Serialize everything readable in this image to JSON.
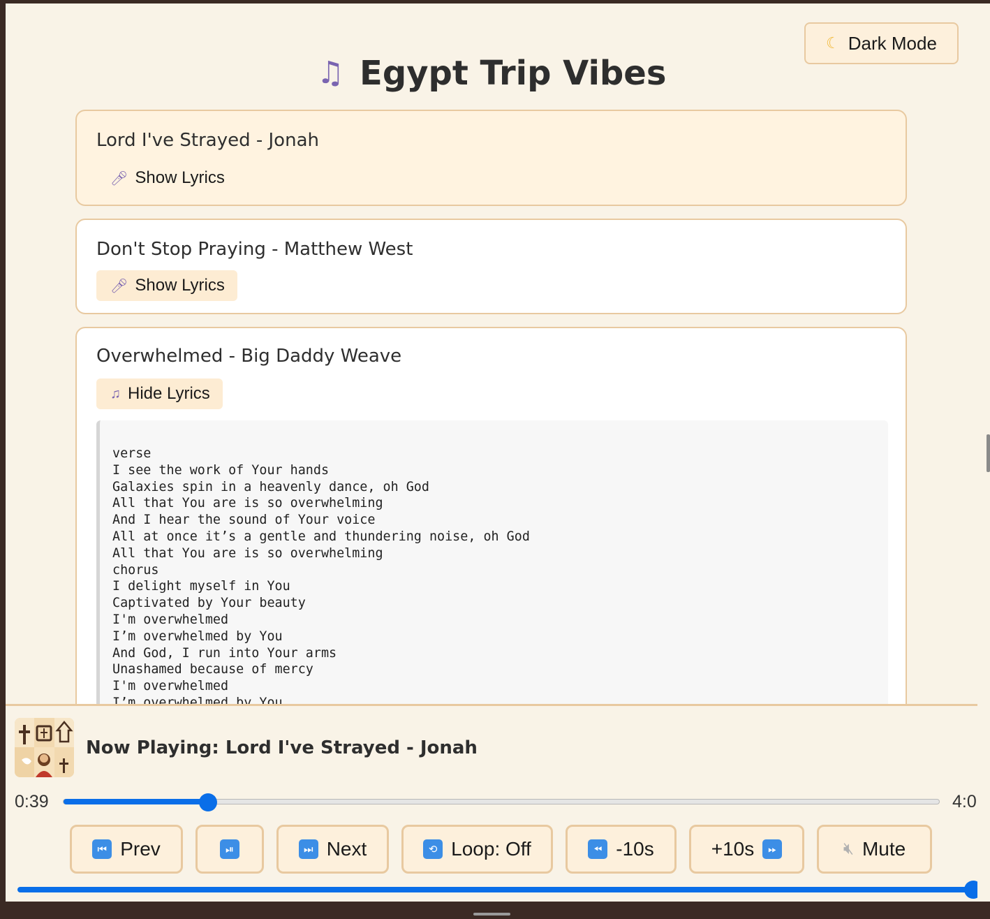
{
  "header": {
    "title": "Egypt Trip Vibes",
    "title_icon": "music-notes-icon",
    "dark_mode_label": "Dark Mode",
    "dark_mode_icon": "moon-icon"
  },
  "songs": [
    {
      "title": "Lord I've Strayed - Jonah",
      "button_label": "Show Lyrics",
      "button_icon": "microphone-icon",
      "active": true
    },
    {
      "title": "Don't Stop Praying - Matthew West",
      "button_label": "Show Lyrics",
      "button_icon": "microphone-icon",
      "active": false
    },
    {
      "title": "Overwhelmed - Big Daddy Weave",
      "button_label": "Hide Lyrics",
      "button_icon": "music-note-icon",
      "active": false,
      "lyrics": "verse\nI see the work of Your hands\nGalaxies spin in a heavenly dance, oh God\nAll that You are is so overwhelming\nAnd I hear the sound of Your voice\nAll at once it’s a gentle and thundering noise, oh God\nAll that You are is so overwhelming\nchorus\nI delight myself in You\nCaptivated by Your beauty\nI'm overwhelmed\nI’m overwhelmed by You\nAnd God, I run into Your arms\nUnashamed because of mercy\nI'm overwhelmed\nI’m overwhelmed by You"
    }
  ],
  "player": {
    "now_playing": "Now Playing: Lord I've Strayed - Jonah",
    "cover_icon": "christian-collage-icon",
    "current_time": "0:39",
    "duration": "4:0",
    "progress_fraction": 0.165,
    "volume_fraction": 1.0,
    "controls": {
      "prev": "Prev",
      "next": "Next",
      "loop": "Loop: Off",
      "back10": "-10s",
      "fwd10": "+10s",
      "mute": "Mute"
    }
  }
}
